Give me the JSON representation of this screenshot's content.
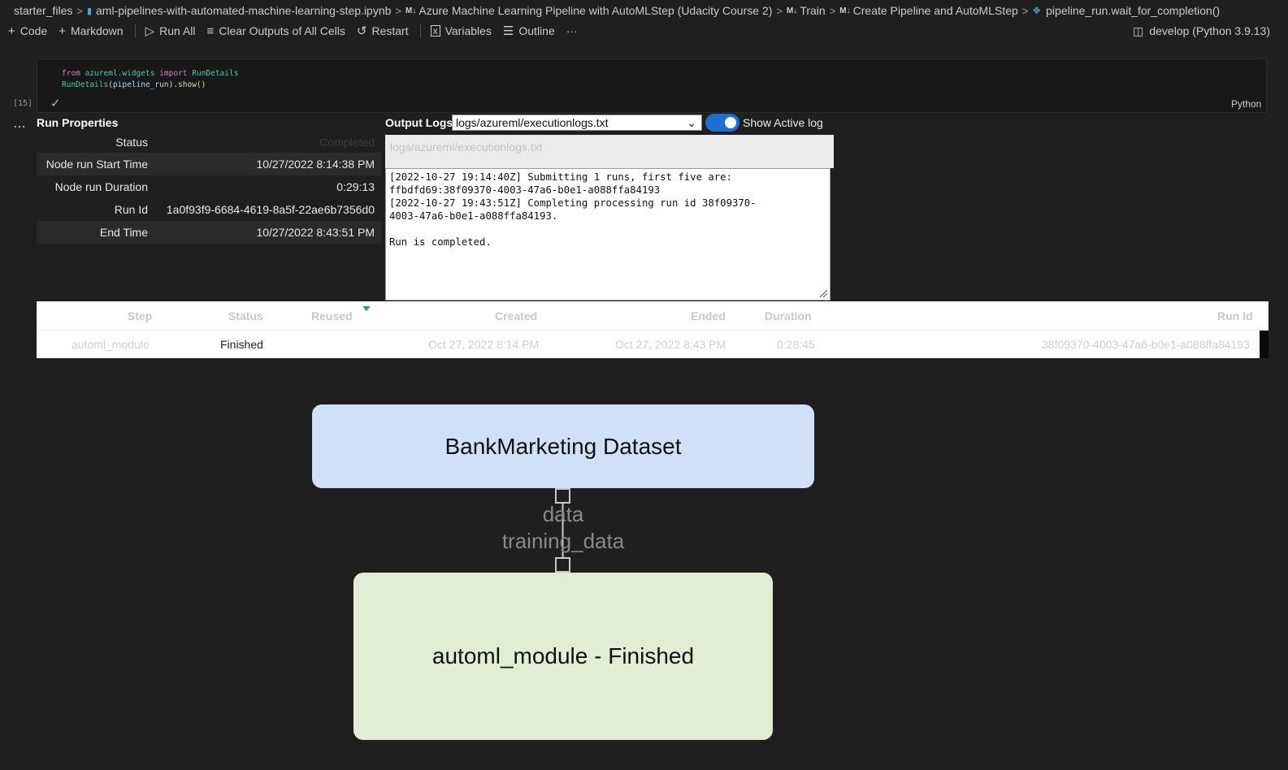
{
  "breadcrumb": {
    "items": [
      "starter_files",
      "aml-pipelines-with-automated-machine-learning-step.ipynb",
      "Azure Machine Learning Pipeline with AutoMLStep (Udacity Course 2)",
      "Train",
      "Create Pipeline and AutoMLStep",
      "pipeline_run.wait_for_completion()"
    ],
    "md_marker": "M↓"
  },
  "toolbar": {
    "code": "Code",
    "markdown": "Markdown",
    "run_all": "Run All",
    "clear_outputs": "Clear Outputs of All Cells",
    "restart": "Restart",
    "variables": "Variables",
    "outline": "Outline",
    "more": "···",
    "kernel": "develop (Python 3.9.13)"
  },
  "cell": {
    "exec_count": "[15]",
    "language": "Python",
    "code": {
      "from": "from",
      "module": "azureml.widgets",
      "import": "import",
      "name": "RunDetails",
      "fn": "RunDetails",
      "arg": "pipeline_run",
      "show": ".show()"
    }
  },
  "run_properties": {
    "title": "Run Properties",
    "rows": [
      {
        "key": "Status",
        "value": "Completed"
      },
      {
        "key": "Node run Start Time",
        "value": "10/27/2022 8:14:38 PM"
      },
      {
        "key": "Node run Duration",
        "value": "0:29:13"
      },
      {
        "key": "Run Id",
        "value": "1a0f93f9-6684-4619-8a5f-22ae6b7356d0"
      },
      {
        "key": "End Time",
        "value": "10/27/2022 8:43:51 PM"
      }
    ]
  },
  "output_logs": {
    "label": "Output Logs",
    "selected_file": "logs/azureml/executionlogs.txt",
    "toggle_label": "Show Active log",
    "path_display": "logs/azureml/executionlogs.txt",
    "log_text": "[2022-10-27 19:14:40Z] Submitting 1 runs, first five are:\nffbdfd69:38f09370-4003-47a6-b0e1-a088ffa84193\n[2022-10-27 19:43:51Z] Completing processing run id 38f09370-\n4003-47a6-b0e1-a088ffa84193.\n\nRun is completed."
  },
  "steps_table": {
    "headers": {
      "step": "Step",
      "status": "Status",
      "reused": "Reused",
      "created": "Created",
      "ended": "Ended",
      "duration": "Duration",
      "run_id": "Run Id"
    },
    "rows": [
      {
        "step": "automl_module",
        "status": "Finished",
        "reused": "",
        "created": "Oct 27, 2022 8:14 PM",
        "ended": "Oct 27, 2022 8:43 PM",
        "duration": "0:28:45",
        "run_id": "38f09370-4003-47a6-b0e1-a088ffa84193"
      }
    ]
  },
  "graph": {
    "source_node": "BankMarketing Dataset",
    "target_node": "automl_module - Finished",
    "edge_out_label": "data",
    "edge_in_label": "training_data"
  },
  "colors": {
    "background": "#1f1f1f",
    "dataset_node": "#cfe0f7",
    "module_node": "#e1eed3",
    "toggle_on": "#1e6fd0",
    "success_check": "#89d185",
    "sort_indicator": "#17a889"
  }
}
